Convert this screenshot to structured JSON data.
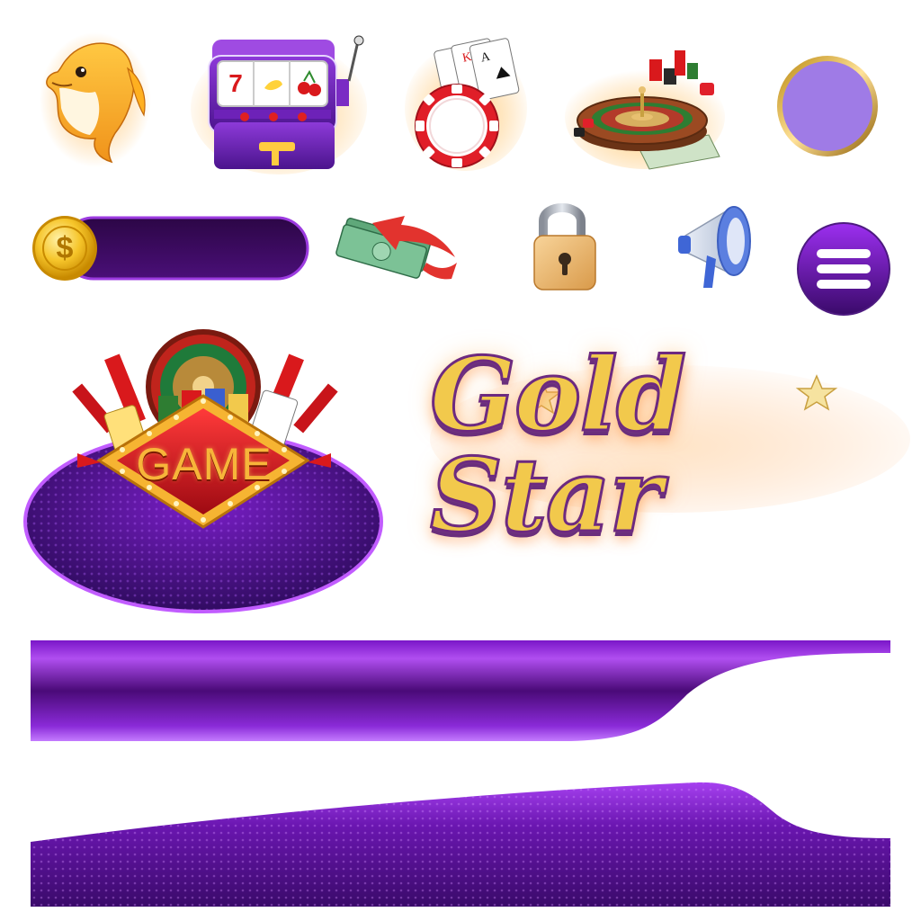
{
  "sprites": {
    "dolphin": "dolphin-icon",
    "slot_machine": "slot-machine-icon",
    "cards_chip": "casino-chip-cards-icon",
    "roulette": "roulette-wheel-icon",
    "purple_circle": "circle-button-icon",
    "coin_bar": "coin-balance-bar",
    "money_arrow": "cash-transfer-icon",
    "lock": "padlock-icon",
    "megaphone": "megaphone-icon",
    "menu": "hamburger-menu-icon"
  },
  "coin_symbol": "$",
  "game_sign": {
    "label": "GAME"
  },
  "logo": {
    "text": "Gold Star"
  },
  "colors": {
    "purple_dark": "#3a0a5e",
    "purple_mid": "#6a16b0",
    "purple_light": "#9f7be6",
    "gold": "#f2c94c",
    "red": "#d9191c"
  }
}
